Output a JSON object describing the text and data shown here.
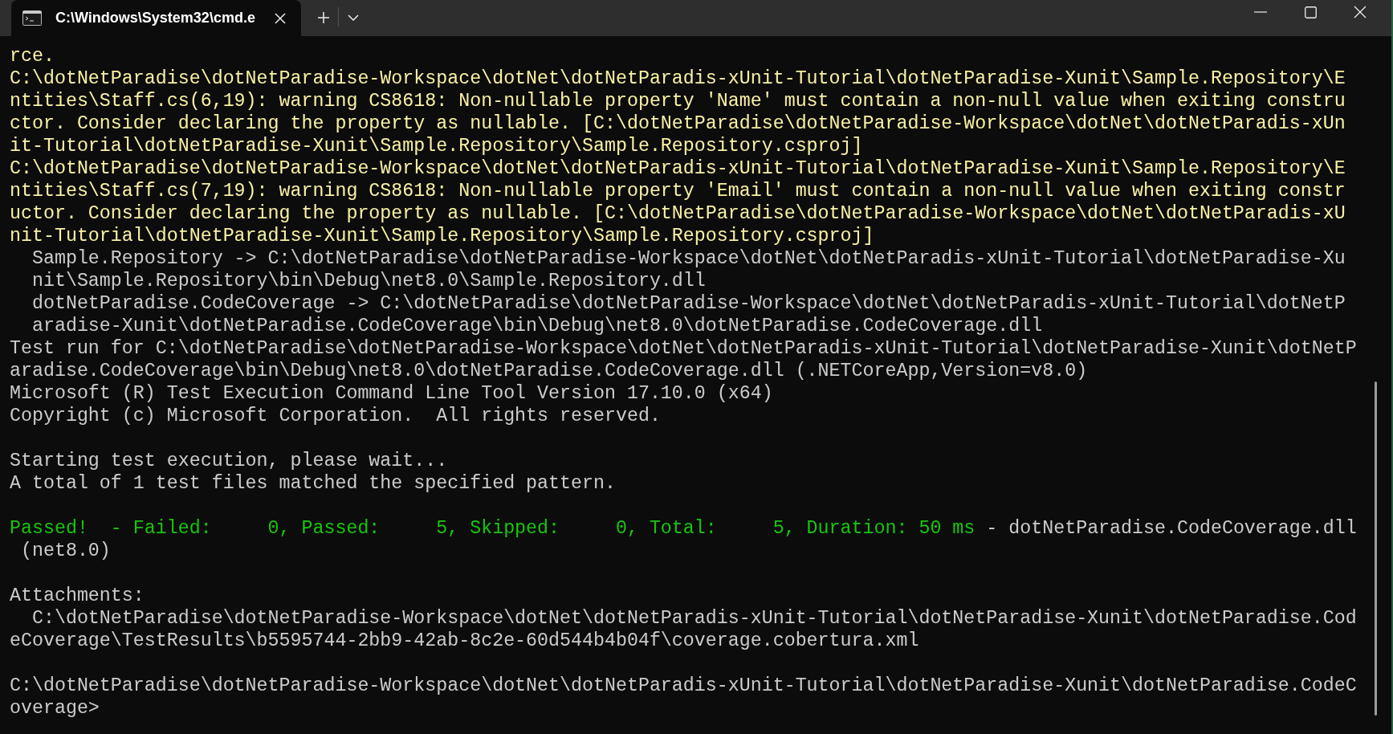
{
  "tab": {
    "title": "C:\\Windows\\System32\\cmd.e"
  },
  "lines": [
    {
      "kind": "output",
      "segments": [
        {
          "text": "rce.",
          "kind": "warning"
        }
      ]
    },
    {
      "kind": "output",
      "segments": [
        {
          "text": "C:\\dotNetParadise\\dotNetParadise-Workspace\\dotNet\\dotNetParadis-xUnit-Tutorial\\dotNetParadise-Xunit\\Sample.Repository\\E",
          "kind": "warning"
        }
      ]
    },
    {
      "kind": "output",
      "segments": [
        {
          "text": "ntities\\Staff.cs(6,19): warning CS8618: Non-nullable property 'Name' must contain a non-null value when exiting constru",
          "kind": "warning"
        }
      ]
    },
    {
      "kind": "output",
      "segments": [
        {
          "text": "ctor. Consider declaring the property as nullable. [C:\\dotNetParadise\\dotNetParadise-Workspace\\dotNet\\dotNetParadis-xUn",
          "kind": "warning"
        }
      ]
    },
    {
      "kind": "output",
      "segments": [
        {
          "text": "it-Tutorial\\dotNetParadise-Xunit\\Sample.Repository\\Sample.Repository.csproj]",
          "kind": "warning"
        }
      ]
    },
    {
      "kind": "output",
      "segments": [
        {
          "text": "C:\\dotNetParadise\\dotNetParadise-Workspace\\dotNet\\dotNetParadis-xUnit-Tutorial\\dotNetParadise-Xunit\\Sample.Repository\\E",
          "kind": "warning"
        }
      ]
    },
    {
      "kind": "output",
      "segments": [
        {
          "text": "ntities\\Staff.cs(7,19): warning CS8618: Non-nullable property 'Email' must contain a non-null value when exiting constr",
          "kind": "warning"
        }
      ]
    },
    {
      "kind": "output",
      "segments": [
        {
          "text": "uctor. Consider declaring the property as nullable. [C:\\dotNetParadise\\dotNetParadise-Workspace\\dotNet\\dotNetParadis-xU",
          "kind": "warning"
        }
      ]
    },
    {
      "kind": "output",
      "segments": [
        {
          "text": "nit-Tutorial\\dotNetParadise-Xunit\\Sample.Repository\\Sample.Repository.csproj]",
          "kind": "warning"
        }
      ]
    },
    {
      "kind": "output",
      "segments": [
        {
          "text": "  Sample.Repository -> C:\\dotNetParadise\\dotNetParadise-Workspace\\dotNet\\dotNetParadis-xUnit-Tutorial\\dotNetParadise-Xu",
          "kind": "normal"
        }
      ]
    },
    {
      "kind": "output",
      "segments": [
        {
          "text": "  nit\\Sample.Repository\\bin\\Debug\\net8.0\\Sample.Repository.dll",
          "kind": "normal"
        }
      ]
    },
    {
      "kind": "output",
      "segments": [
        {
          "text": "  dotNetParadise.CodeCoverage -> C:\\dotNetParadise\\dotNetParadise-Workspace\\dotNet\\dotNetParadis-xUnit-Tutorial\\dotNetP",
          "kind": "normal"
        }
      ]
    },
    {
      "kind": "output",
      "segments": [
        {
          "text": "  aradise-Xunit\\dotNetParadise.CodeCoverage\\bin\\Debug\\net8.0\\dotNetParadise.CodeCoverage.dll",
          "kind": "normal"
        }
      ]
    },
    {
      "kind": "output",
      "segments": [
        {
          "text": "Test run for C:\\dotNetParadise\\dotNetParadise-Workspace\\dotNet\\dotNetParadis-xUnit-Tutorial\\dotNetParadise-Xunit\\dotNetP",
          "kind": "normal"
        }
      ]
    },
    {
      "kind": "output",
      "segments": [
        {
          "text": "aradise.CodeCoverage\\bin\\Debug\\net8.0\\dotNetParadise.CodeCoverage.dll (.NETCoreApp,Version=v8.0)",
          "kind": "normal"
        }
      ]
    },
    {
      "kind": "output",
      "segments": [
        {
          "text": "Microsoft (R) Test Execution Command Line Tool Version 17.10.0 (x64)",
          "kind": "normal"
        }
      ]
    },
    {
      "kind": "output",
      "segments": [
        {
          "text": "Copyright (c) Microsoft Corporation.  All rights reserved.",
          "kind": "normal"
        }
      ]
    },
    {
      "kind": "blank"
    },
    {
      "kind": "output",
      "segments": [
        {
          "text": "Starting test execution, please wait...",
          "kind": "normal"
        }
      ]
    },
    {
      "kind": "output",
      "segments": [
        {
          "text": "A total of 1 test files matched the specified pattern.",
          "kind": "normal"
        }
      ]
    },
    {
      "kind": "blank"
    },
    {
      "kind": "output",
      "segments": [
        {
          "text": "Passed!  - Failed:     0, Passed:     5, Skipped:     0, Total:     5, Duration: 50 ms",
          "kind": "success"
        },
        {
          "text": " - dotNetParadise.CodeCoverage.dll",
          "kind": "normal"
        }
      ]
    },
    {
      "kind": "output",
      "segments": [
        {
          "text": " (net8.0)",
          "kind": "normal"
        }
      ]
    },
    {
      "kind": "blank"
    },
    {
      "kind": "output",
      "segments": [
        {
          "text": "Attachments:",
          "kind": "normal"
        }
      ]
    },
    {
      "kind": "output",
      "segments": [
        {
          "text": "  C:\\dotNetParadise\\dotNetParadise-Workspace\\dotNet\\dotNetParadis-xUnit-Tutorial\\dotNetParadise-Xunit\\dotNetParadise.Cod",
          "kind": "normal"
        }
      ]
    },
    {
      "kind": "output",
      "segments": [
        {
          "text": "eCoverage\\TestResults\\b5595744-2bb9-42ab-8c2e-60d544b4b04f\\coverage.cobertura.xml",
          "kind": "normal"
        }
      ]
    },
    {
      "kind": "blank"
    },
    {
      "kind": "output",
      "segments": [
        {
          "text": "C:\\dotNetParadise\\dotNetParadise-Workspace\\dotNet\\dotNetParadis-xUnit-Tutorial\\dotNetParadise-Xunit\\dotNetParadise.CodeC",
          "kind": "normal"
        }
      ]
    },
    {
      "kind": "output",
      "segments": [
        {
          "text": "overage>",
          "kind": "normal"
        }
      ]
    }
  ]
}
